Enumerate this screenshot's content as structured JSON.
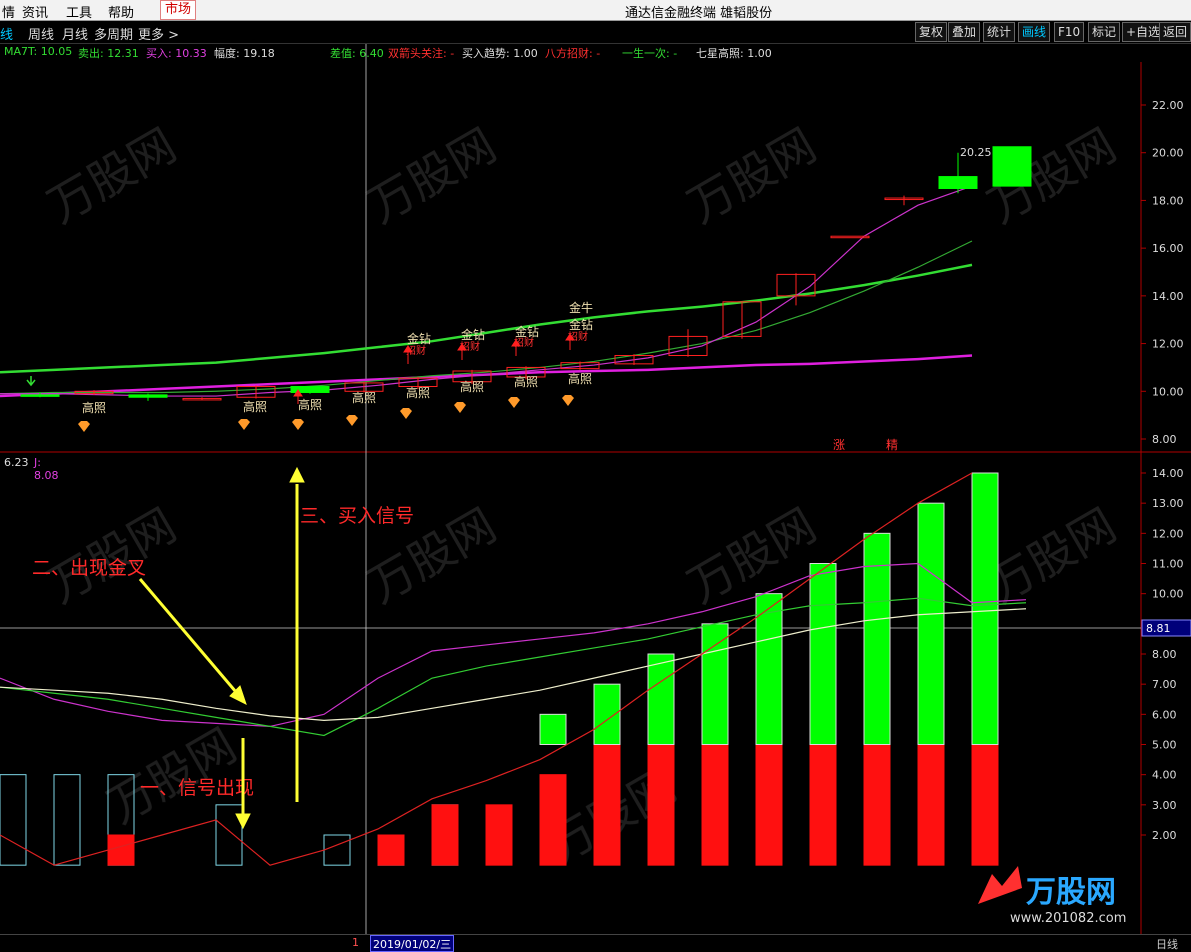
{
  "menu": {
    "items": [
      "情",
      "资讯",
      "工具",
      "帮助",
      "市场"
    ],
    "app_title": "通达信金融终端",
    "stock_name": "雄韬股份"
  },
  "toolbar": {
    "periods": [
      "日线",
      "周线",
      "月线",
      "多周期",
      "更多 >"
    ],
    "right_buttons": [
      "复权",
      "叠加",
      "统计",
      "画线",
      "F10",
      "标记",
      "+自选",
      "返回"
    ]
  },
  "indicator_line_main": {
    "ma7t": "MA7T: 10.05",
    "sell": "卖出: 12.31",
    "buy": "买入: 10.33",
    "amplitude": "幅度: 19.18",
    "diff": "差值: 6.40",
    "double_head": "双箭头关注: -",
    "buy_trend": "买入趋势: 1.00",
    "eight_way": "八方招财: -",
    "once_life": "一生一次: -",
    "seven_star": "七星高照: 1.00"
  },
  "indicator_line_sub": {
    "left_value": "6.23",
    "j_value": "J: 8.08"
  },
  "main_axis": [
    "22.00",
    "20.00",
    "18.00",
    "16.00",
    "14.00",
    "12.00",
    "10.00",
    "8.00"
  ],
  "sub_axis": [
    "14.00",
    "13.00",
    "12.00",
    "11.00",
    "10.00",
    "9.00",
    "8.00",
    "7.00",
    "6.00",
    "5.00",
    "4.00",
    "3.00",
    "2.00"
  ],
  "crosshair_value": "8.81",
  "price_label_high": "20.25",
  "chart_labels": {
    "gaozhao": "高照",
    "jinzuan": "金钻",
    "jinniu": "金牛",
    "zhao_cai": "招财",
    "zhang": "涨",
    "jing": "精"
  },
  "annotations": {
    "one": "一、信号出现",
    "two": "二、出现金叉",
    "three": "三、买入信号"
  },
  "status_bar": {
    "page": "1",
    "date": "2019/01/02/三",
    "period": "日线"
  },
  "watermark": {
    "brand": "万股网",
    "url": "www.201082.com"
  },
  "colors": {
    "up": "#ff2020",
    "down": "#00ff00",
    "ma_green": "#33dd33",
    "ma_magenta": "#e020e0",
    "annotation": "#ff2a2a",
    "arrow": "#ffff33"
  },
  "chart_data": [
    {
      "type": "candlestick",
      "title": "",
      "ylim": [
        7.5,
        23
      ],
      "yticks": [
        8,
        10,
        12,
        14,
        16,
        18,
        20,
        22
      ],
      "candles": [
        {
          "o": 9.85,
          "c": 9.8,
          "h": 9.95,
          "l": 9.75
        },
        {
          "o": 9.9,
          "c": 10.0,
          "h": 10.05,
          "l": 9.85
        },
        {
          "o": 9.85,
          "c": 9.75,
          "h": 9.9,
          "l": 9.6
        },
        {
          "o": 9.7,
          "c": 9.7,
          "h": 9.75,
          "l": 9.65
        },
        {
          "o": 9.75,
          "c": 10.2,
          "h": 10.25,
          "l": 9.7
        },
        {
          "o": 10.2,
          "c": 9.95,
          "h": 10.2,
          "l": 9.9
        },
        {
          "o": 10.0,
          "c": 10.35,
          "h": 10.4,
          "l": 9.95
        },
        {
          "o": 10.2,
          "c": 10.55,
          "h": 10.6,
          "l": 10.1
        },
        {
          "o": 10.4,
          "c": 10.85,
          "h": 10.9,
          "l": 10.3
        },
        {
          "o": 10.6,
          "c": 11.0,
          "h": 11.05,
          "l": 10.5
        },
        {
          "o": 10.95,
          "c": 11.2,
          "h": 11.25,
          "l": 10.9
        },
        {
          "o": 11.15,
          "c": 11.5,
          "h": 11.55,
          "l": 11.1
        },
        {
          "o": 11.5,
          "c": 12.3,
          "h": 12.6,
          "l": 11.45
        },
        {
          "o": 12.3,
          "c": 13.75,
          "h": 13.75,
          "l": 12.2
        },
        {
          "o": 14.0,
          "c": 14.9,
          "h": 14.95,
          "l": 13.6
        },
        {
          "o": 16.5,
          "c": 16.5,
          "h": 16.5,
          "l": 16.5
        },
        {
          "o": 18.1,
          "c": 18.1,
          "h": 18.2,
          "l": 17.8
        },
        {
          "o": 19.0,
          "c": 18.5,
          "h": 20.0,
          "l": 18.3
        },
        {
          "o": 20.25,
          "c": 18.6,
          "h": 20.25,
          "l": 18.6
        }
      ],
      "series": [
        {
          "color": "#33dd33",
          "values": [
            10.8,
            10.9,
            11.0,
            11.1,
            11.2,
            11.4,
            11.6,
            11.85,
            12.1,
            12.45,
            12.8,
            13.1,
            13.35,
            13.55,
            13.8,
            14.1,
            14.45,
            14.85,
            15.3
          ]
        },
        {
          "color": "#e020e0",
          "values": [
            9.8,
            9.9,
            10.0,
            10.1,
            10.2,
            10.3,
            10.4,
            10.5,
            10.6,
            10.7,
            10.8,
            10.85,
            10.9,
            11.0,
            11.1,
            11.15,
            11.25,
            11.35,
            11.5
          ]
        },
        {
          "color": "#33aa33",
          "values": [
            9.9,
            9.95,
            9.95,
            9.95,
            10.0,
            10.1,
            10.25,
            10.45,
            10.65,
            10.8,
            11.0,
            11.25,
            11.6,
            12.0,
            12.55,
            13.3,
            14.2,
            15.2,
            16.3
          ]
        },
        {
          "color": "#cc33cc",
          "values": [
            9.9,
            9.9,
            9.85,
            9.8,
            9.8,
            9.95,
            10.05,
            10.25,
            10.5,
            10.7,
            10.9,
            11.1,
            11.4,
            11.9,
            12.9,
            14.4,
            16.5,
            17.8,
            18.6
          ]
        }
      ]
    },
    {
      "type": "bar",
      "title": "",
      "ylim": [
        0.95,
        14.1
      ],
      "yticks": [
        2,
        3,
        4,
        5,
        6,
        7,
        8,
        9,
        10,
        11,
        12,
        13,
        14
      ],
      "outline_bars": [
        4,
        4,
        4,
        null,
        3,
        null,
        2,
        2,
        3,
        null,
        null,
        null,
        null,
        null,
        null,
        null,
        null,
        null,
        null
      ],
      "red_bars": [
        null,
        1,
        2,
        null,
        null,
        null,
        null,
        2,
        3,
        3,
        4,
        5,
        5,
        5,
        5,
        5,
        5,
        5,
        5
      ],
      "green_bars_top": [
        null,
        null,
        null,
        null,
        null,
        null,
        null,
        null,
        null,
        null,
        null,
        6,
        7,
        8,
        9,
        10,
        11,
        12,
        13,
        14
      ],
      "lines": [
        {
          "color": "#cc33cc",
          "values": [
            7.2,
            6.5,
            6.1,
            5.8,
            5.7,
            5.6,
            6.0,
            7.2,
            8.1,
            8.3,
            8.5,
            8.7,
            9.0,
            9.4,
            9.9,
            10.6,
            10.9,
            11.0,
            9.7,
            9.8
          ]
        },
        {
          "color": "#33cc33",
          "values": [
            6.9,
            6.7,
            6.5,
            6.2,
            5.9,
            5.6,
            5.3,
            6.2,
            7.2,
            7.6,
            7.9,
            8.2,
            8.5,
            8.9,
            9.3,
            9.6,
            9.7,
            9.85,
            9.6,
            9.7
          ]
        },
        {
          "color": "#eeeecc",
          "values": [
            6.9,
            6.8,
            6.7,
            6.5,
            6.2,
            5.95,
            5.8,
            5.9,
            6.2,
            6.5,
            6.8,
            7.2,
            7.6,
            8.0,
            8.4,
            8.8,
            9.1,
            9.3,
            9.4,
            9.5
          ]
        },
        {
          "color": "#dd2222",
          "values": [
            2.0,
            1.0,
            1.5,
            2.0,
            2.5,
            1.0,
            1.5,
            2.2,
            3.2,
            3.8,
            4.5,
            5.5,
            6.8,
            8.0,
            9.2,
            10.5,
            11.8,
            13.0,
            14.0
          ]
        }
      ]
    }
  ]
}
